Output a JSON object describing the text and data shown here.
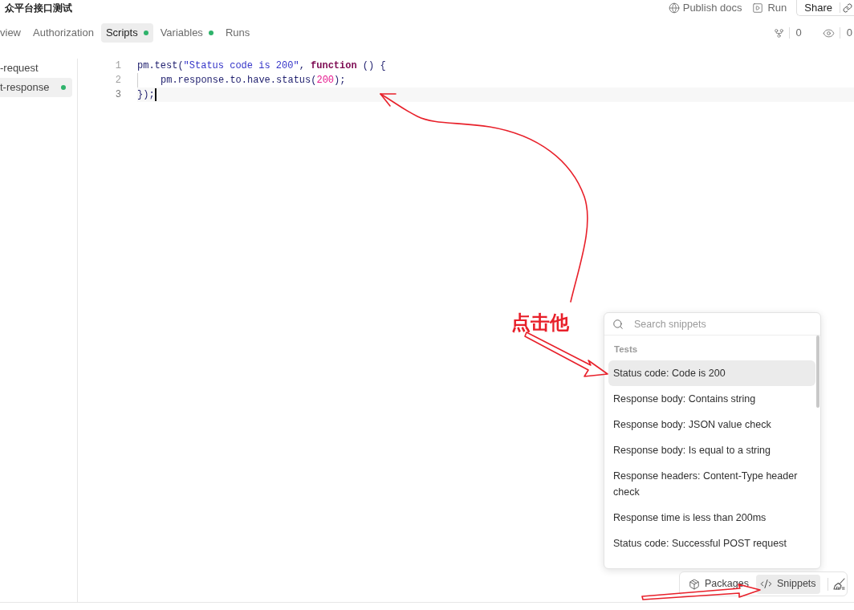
{
  "header": {
    "title": "众平台接口测试",
    "actions": [
      {
        "kind": "publish",
        "label": "Publish docs"
      },
      {
        "kind": "run",
        "label": "Run"
      },
      {
        "kind": "share",
        "label": "Share"
      }
    ]
  },
  "tabs": [
    {
      "label": "view",
      "selected": false,
      "dot": false
    },
    {
      "label": "Authorization",
      "selected": false,
      "dot": false
    },
    {
      "label": "Scripts",
      "selected": true,
      "dot": true
    },
    {
      "label": "Variables",
      "selected": false,
      "dot": true
    },
    {
      "label": "Runs",
      "selected": false,
      "dot": false
    }
  ],
  "counters": [
    {
      "kind": "fork",
      "value": "0"
    },
    {
      "kind": "watch",
      "value": "0"
    }
  ],
  "sidebar": {
    "items": [
      {
        "label": "-request",
        "selected": false,
        "dot": false
      },
      {
        "label": "t-response",
        "selected": true,
        "dot": true
      }
    ]
  },
  "editor": {
    "lines": [
      {
        "number": "1",
        "active": false,
        "indented": false,
        "tokens": [
          {
            "kind": "ident",
            "text": "pm.test("
          },
          {
            "kind": "string",
            "text": "\"Status code is 200\""
          },
          {
            "kind": "punct",
            "text": ", "
          },
          {
            "kind": "keyword",
            "text": "function"
          },
          {
            "kind": "punct",
            "text": " () {"
          }
        ]
      },
      {
        "number": "2",
        "active": false,
        "indented": true,
        "tokens": [
          {
            "kind": "ident",
            "text": "pm.response.to.have.status("
          },
          {
            "kind": "number",
            "text": "200"
          },
          {
            "kind": "punct",
            "text": ");"
          }
        ]
      },
      {
        "number": "3",
        "active": true,
        "indented": false,
        "tokens": [
          {
            "kind": "punct",
            "text": "});"
          }
        ]
      }
    ]
  },
  "snippets": {
    "placeholder": "Search snippets",
    "section": "Tests",
    "items": [
      {
        "label": "Status code: Code is 200",
        "selected": true
      },
      {
        "label": "Response body: Contains string",
        "selected": false
      },
      {
        "label": "Response body: JSON value check",
        "selected": false
      },
      {
        "label": "Response body: Is equal to a string",
        "selected": false
      },
      {
        "label": "Response headers: Content-Type header check",
        "selected": false
      },
      {
        "label": "Response time is less than 200ms",
        "selected": false
      },
      {
        "label": "Status code: Successful POST request",
        "selected": false
      }
    ]
  },
  "toolbar": {
    "buttons": [
      {
        "kind": "packages",
        "label": "Packages",
        "selected": false
      },
      {
        "kind": "snippets",
        "label": "Snippets",
        "selected": true
      },
      {
        "kind": "clean",
        "selected": false
      }
    ]
  },
  "annotation": {
    "callout": "点击他"
  }
}
